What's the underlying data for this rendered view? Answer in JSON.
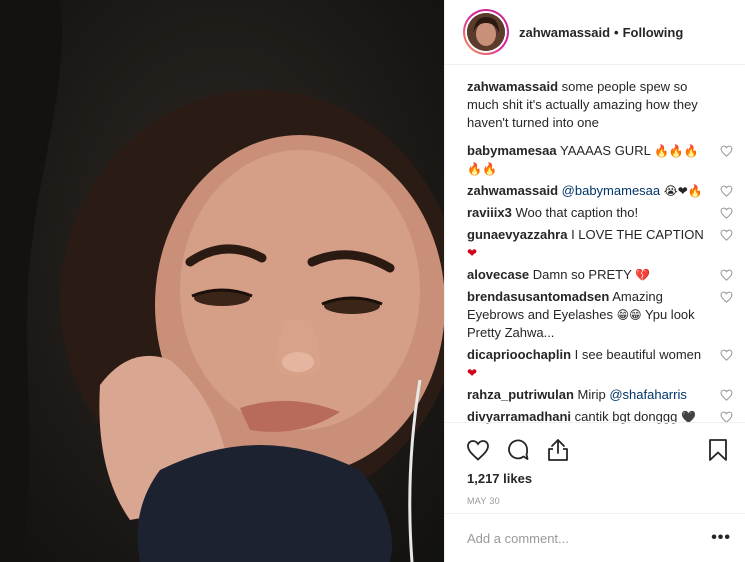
{
  "post": {
    "username": "zahwamassaid",
    "separator": "•",
    "follow_status": "Following",
    "caption": "some people spew so much shit it's actually amazing how they haven't turned into one",
    "likes": "1,217 likes",
    "date": "MAY 30",
    "add_comment_placeholder": "Add a comment...",
    "more_label": "•••"
  },
  "comments": [
    {
      "user": "babymamesaa",
      "text": "YAAAAS GURL",
      "emoji": "🔥🔥🔥🔥🔥"
    },
    {
      "user": "zahwamassaid",
      "mention": "@babymamesaa",
      "emoji": "😭❤🔥"
    },
    {
      "user": "raviiix3",
      "text": "Woo that caption tho!"
    },
    {
      "user": "gunaevyazzahra",
      "text": "I LOVE THE CAPTION",
      "emoji": "❤"
    },
    {
      "user": "alovecase",
      "text": "Damn so PRETY",
      "emoji": "💔"
    },
    {
      "user": "brendasusantomadsen",
      "text": "Amazing Eyebrows and Eyelashes",
      "emoji": "😁😁",
      "text2": "Ypu look Pretty Zahwa..."
    },
    {
      "user": "dicaprioochaplin",
      "text": "I see beautiful women",
      "emoji": "❤"
    },
    {
      "user": "rahza_putriwulan",
      "text": "Mirip",
      "mention": "@shafaharris"
    },
    {
      "user": "divyarramadhani",
      "text": "cantik bgt donggg",
      "emoji": "🖤"
    }
  ],
  "icons": {
    "like": "heart-icon",
    "comment": "comment-icon",
    "share": "share-icon",
    "save": "bookmark-icon",
    "comment_like": "heart-icon"
  },
  "colors": {
    "text": "#262626",
    "mention": "#003569",
    "muted": "#999999",
    "border": "#efefef"
  }
}
